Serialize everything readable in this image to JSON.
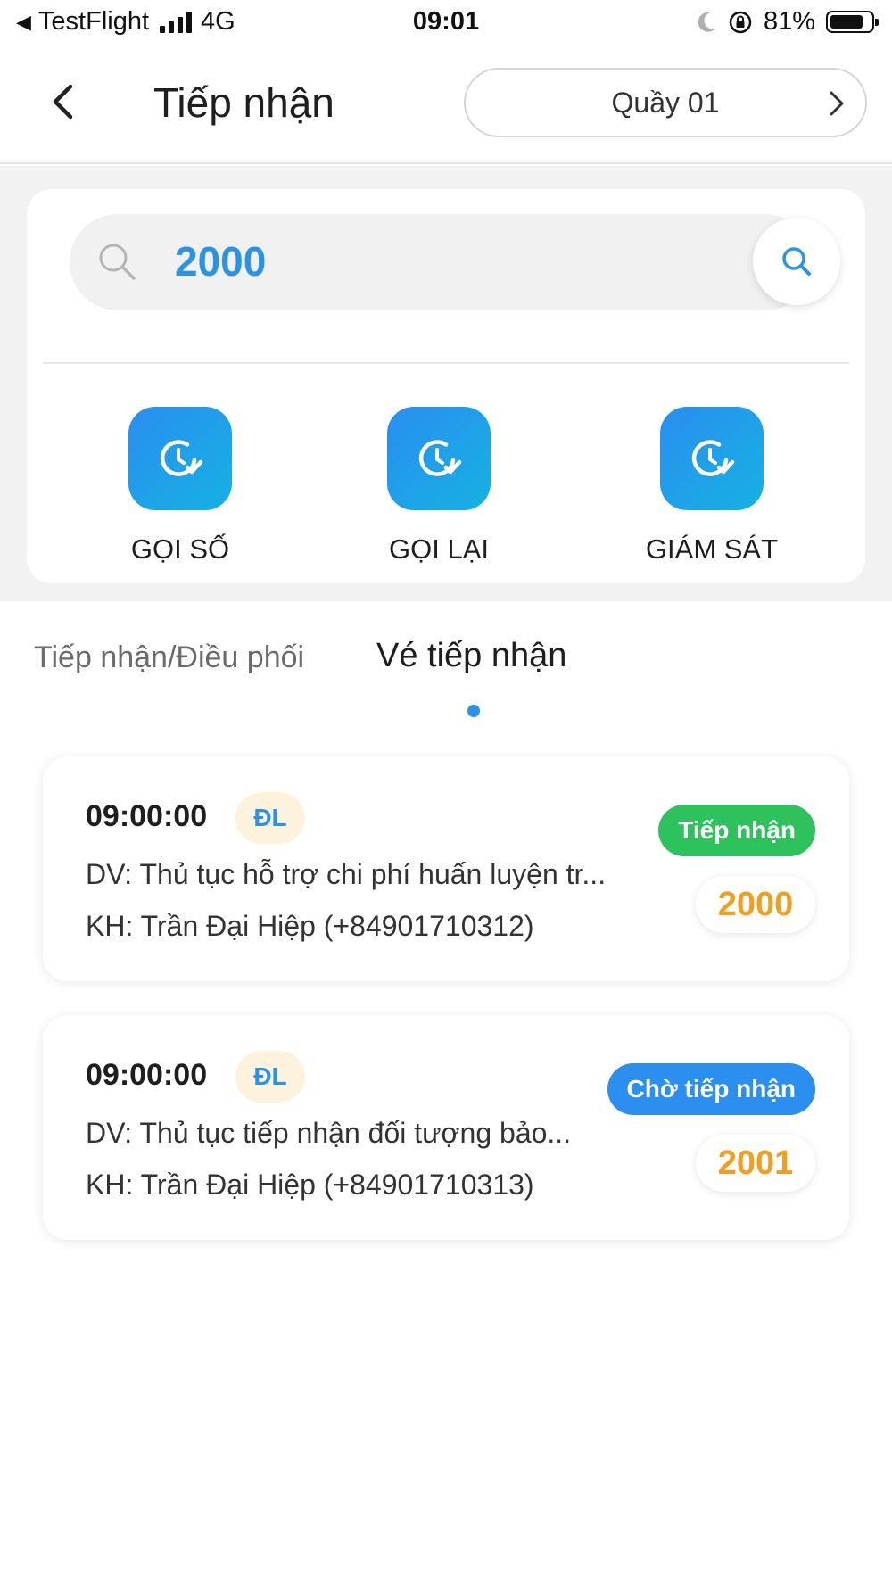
{
  "status_bar": {
    "carrier": "TestFlight",
    "network": "4G",
    "time": "09:01",
    "battery": "81%",
    "battery_level": 0.81
  },
  "header": {
    "title": "Tiếp nhận",
    "counter_label": "Quầy 01"
  },
  "search": {
    "value": "2000"
  },
  "actions": [
    {
      "label": "GỌI SỐ",
      "icon": "clock-check-icon"
    },
    {
      "label": "GỌI LẠI",
      "icon": "clock-check-icon"
    },
    {
      "label": "GIÁM SÁT",
      "icon": "clock-check-icon"
    }
  ],
  "tabs": [
    {
      "label": "Tiếp nhận/Điều phối",
      "active": false
    },
    {
      "label": "Vé tiếp nhận",
      "active": true
    }
  ],
  "tickets": [
    {
      "time": "09:00:00",
      "tag": "ĐL",
      "service": "DV: Thủ tục hỗ trợ chi phí huấn luyện tr...",
      "customer": "KH: Trần Đại Hiệp (+84901710312)",
      "status": "Tiếp nhận",
      "status_color": "#2dc25c",
      "number": "2000"
    },
    {
      "time": "09:00:00",
      "tag": "ĐL",
      "service": "DV: Thủ tục tiếp nhận đối tượng bảo...",
      "customer": "KH: Trần Đại Hiệp (+84901710313)",
      "status": "Chờ tiếp nhận",
      "status_color": "#2b8ff0",
      "number": "2001"
    }
  ],
  "colors": {
    "accent": "#2b93e6",
    "number": "#f0a020",
    "tag_bg": "#fdf3dc"
  }
}
